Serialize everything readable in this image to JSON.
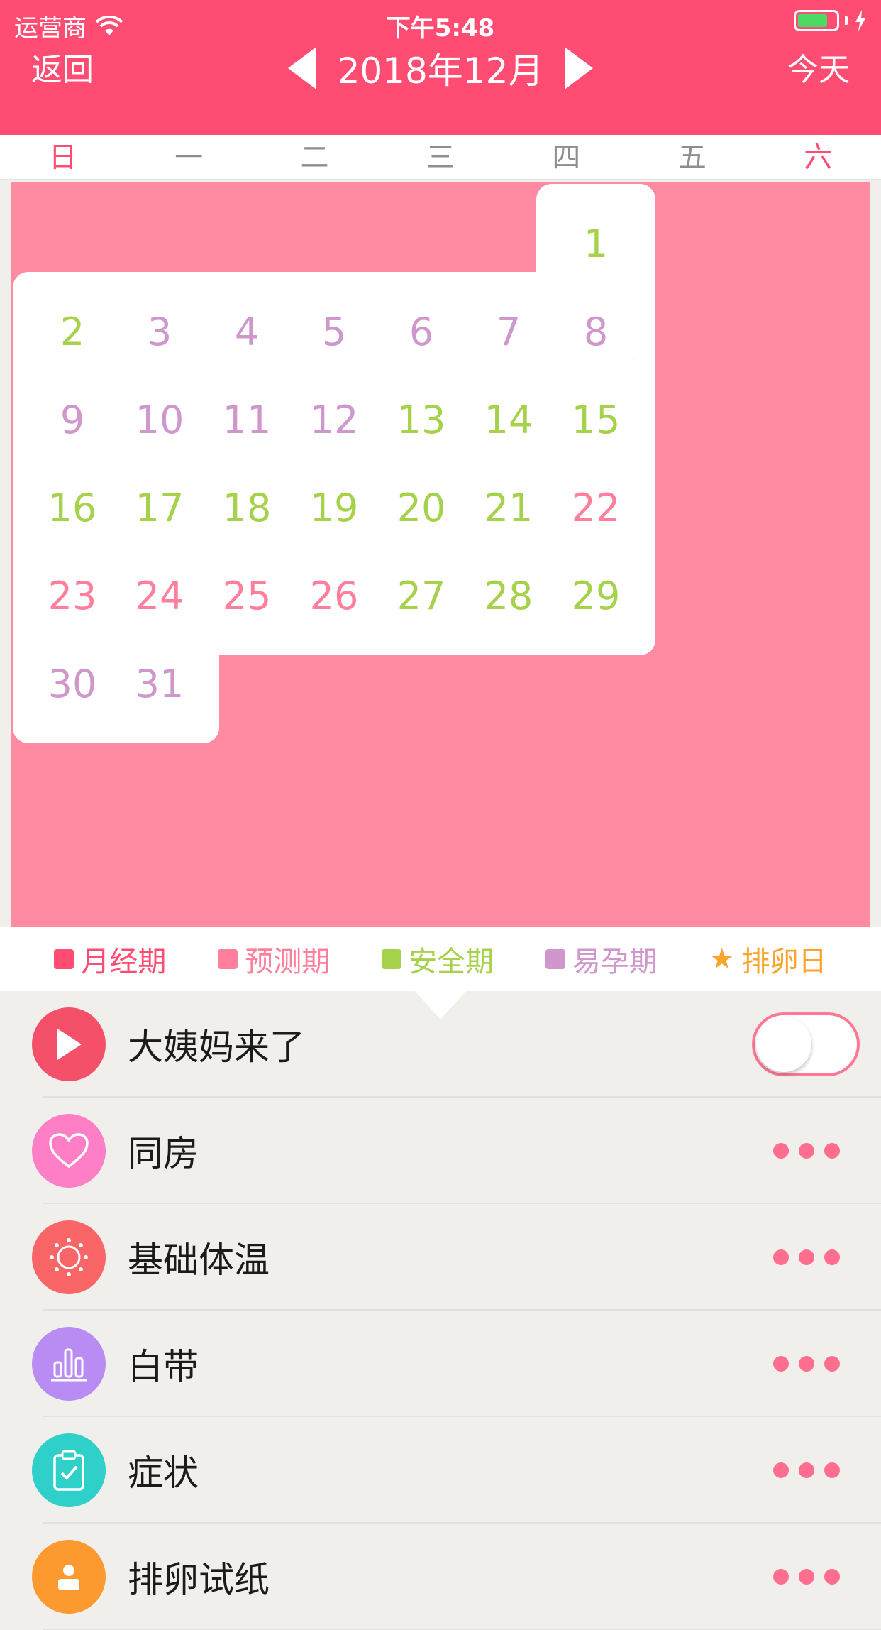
{
  "status_bar": {
    "carrier": "运营商",
    "time": "下午5:48"
  },
  "header": {
    "back_label": "返回",
    "month_title": "2018年12月",
    "today_label": "今天"
  },
  "weekdays": [
    "日",
    "一",
    "二",
    "三",
    "四",
    "五",
    "六"
  ],
  "calendar": {
    "today_label": "今天",
    "days": [
      {
        "day": "1",
        "type": "safe"
      },
      {
        "day": "2",
        "type": "safe"
      },
      {
        "day": "3",
        "type": "fertile"
      },
      {
        "day": "4",
        "type": "fertile"
      },
      {
        "day": "5",
        "type": "fertile"
      },
      {
        "day": "6",
        "type": "fertile"
      },
      {
        "day": "7",
        "type": "fertile"
      },
      {
        "day": "8",
        "type": "fertile",
        "ovulation": true
      },
      {
        "day": "9",
        "type": "fertile"
      },
      {
        "day": "10",
        "type": "fertile"
      },
      {
        "day": "11",
        "type": "fertile"
      },
      {
        "day": "12",
        "type": "fertile"
      },
      {
        "day": "13",
        "type": "safe"
      },
      {
        "day": "14",
        "type": "safe"
      },
      {
        "day": "15",
        "type": "safe"
      },
      {
        "day": "16",
        "type": "safe"
      },
      {
        "day": "17",
        "type": "safe"
      },
      {
        "day": "18",
        "type": "safe"
      },
      {
        "day": "19",
        "type": "safe"
      },
      {
        "day": "20",
        "type": "safe"
      },
      {
        "day": "21",
        "type": "safe"
      },
      {
        "day": "22",
        "type": "predicted"
      },
      {
        "day": "23",
        "type": "predicted",
        "today": true
      },
      {
        "day": "24",
        "type": "predicted"
      },
      {
        "day": "25",
        "type": "predicted"
      },
      {
        "day": "26",
        "type": "predicted"
      },
      {
        "day": "27",
        "type": "safe"
      },
      {
        "day": "28",
        "type": "safe"
      },
      {
        "day": "29",
        "type": "safe"
      },
      {
        "day": "30",
        "type": "fertile"
      },
      {
        "day": "31",
        "type": "fertile"
      }
    ],
    "first_weekday": 6
  },
  "colors": {
    "period": "#ff4c72",
    "predicted": "#ff7f9c",
    "safe": "#a5d24a",
    "fertile": "#cf97cc",
    "ovulation": "#fba42c"
  },
  "legend": [
    {
      "label": "月经期",
      "color": "#ff4c72",
      "marker": "square"
    },
    {
      "label": "预测期",
      "color": "#ff7f9c",
      "marker": "square"
    },
    {
      "label": "安全期",
      "color": "#a5d24a",
      "marker": "square"
    },
    {
      "label": "易孕期",
      "color": "#cf97cc",
      "marker": "square"
    },
    {
      "label": "排卵日",
      "color": "#fba42c",
      "marker": "star"
    }
  ],
  "list": [
    {
      "label": "大姨妈来了",
      "icon": "play-icon",
      "icon_bg": "#f4506a",
      "control": "toggle",
      "toggle_on": false
    },
    {
      "label": "同房",
      "icon": "heart-icon",
      "icon_bg": "#fe7fc5",
      "control": "more"
    },
    {
      "label": "基础体温",
      "icon": "sun-icon",
      "icon_bg": "#fa6567",
      "control": "more"
    },
    {
      "label": "白带",
      "icon": "bar-chart-icon",
      "icon_bg": "#b98cf3",
      "control": "more"
    },
    {
      "label": "症状",
      "icon": "clipboard-icon",
      "icon_bg": "#2fcfca",
      "control": "more"
    },
    {
      "label": "排卵试纸",
      "icon": "test-paper-icon",
      "icon_bg": "#fd9a2f",
      "control": "more"
    }
  ]
}
